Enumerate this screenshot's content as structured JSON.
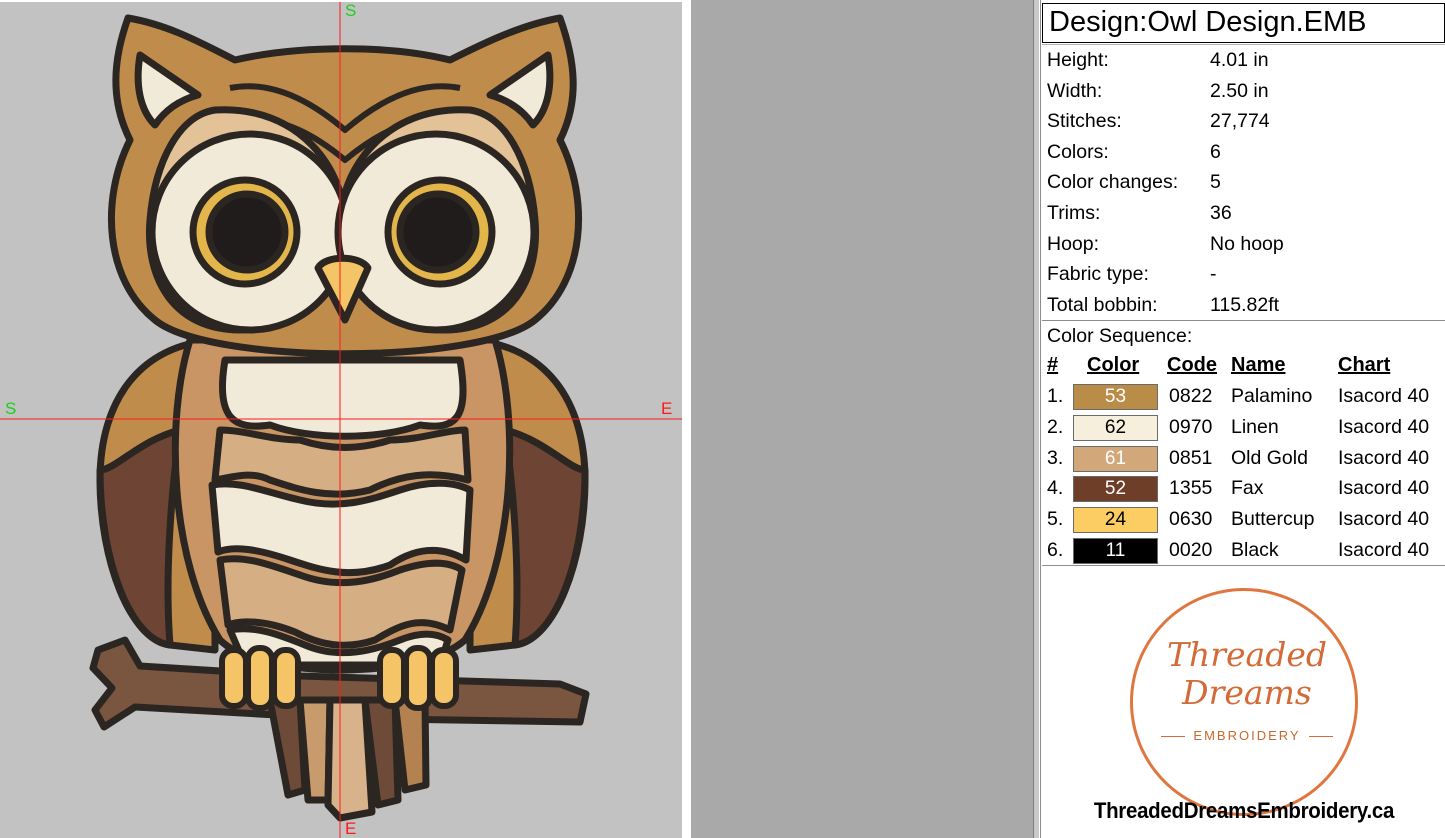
{
  "canvas": {
    "markers": {
      "top": "S",
      "left": "S",
      "right": "E",
      "bottom": "E"
    },
    "colors": {
      "start_marker": "#1bd01b",
      "end_marker": "#ff1a1a",
      "background": "#c2c2c2"
    }
  },
  "info": {
    "title": "Design:Owl Design.EMB",
    "properties": [
      {
        "label": "Height:",
        "value": "4.01 in"
      },
      {
        "label": "Width:",
        "value": "2.50 in"
      },
      {
        "label": "Stitches:",
        "value": "27,774"
      },
      {
        "label": "Colors:",
        "value": "6"
      },
      {
        "label": "Color changes:",
        "value": "5"
      },
      {
        "label": "Trims:",
        "value": "36"
      },
      {
        "label": "Hoop:",
        "value": "No hoop"
      },
      {
        "label": "Fabric type:",
        "value": "-"
      },
      {
        "label": "Total bobbin:",
        "value": "115.82ft"
      }
    ],
    "sequence_title": "Color Sequence:",
    "sequence_headers": {
      "num": "#",
      "color": "Color",
      "code": "Code",
      "name": "Name",
      "chart": "Chart"
    },
    "sequence": [
      {
        "num": "1.",
        "swatch": "53",
        "hex": "#b98c48",
        "text": "#ffffff",
        "code": "0822",
        "name": "Palamino",
        "chart": "Isacord 40"
      },
      {
        "num": "2.",
        "swatch": "62",
        "hex": "#f5efdc",
        "text": "#000000",
        "code": "0970",
        "name": "Linen",
        "chart": "Isacord 40"
      },
      {
        "num": "3.",
        "swatch": "61",
        "hex": "#d2a77a",
        "text": "#ffffff",
        "code": "0851",
        "name": "Old Gold",
        "chart": "Isacord 40"
      },
      {
        "num": "4.",
        "swatch": "52",
        "hex": "#6e3e28",
        "text": "#ffffff",
        "code": "1355",
        "name": "Fax",
        "chart": "Isacord 40"
      },
      {
        "num": "5.",
        "swatch": "24",
        "hex": "#fbcd62",
        "text": "#000000",
        "code": "0630",
        "name": "Buttercup",
        "chart": "Isacord 40"
      },
      {
        "num": "6.",
        "swatch": "11",
        "hex": "#000000",
        "text": "#ffffff",
        "code": "0020",
        "name": "Black",
        "chart": "Isacord 40"
      }
    ]
  },
  "logo": {
    "line1": "Threaded",
    "line2": "Dreams",
    "line3": "EMBROIDERY",
    "website": "ThreadedDreamsEmbroidery.ca",
    "color": "#d36a37"
  }
}
